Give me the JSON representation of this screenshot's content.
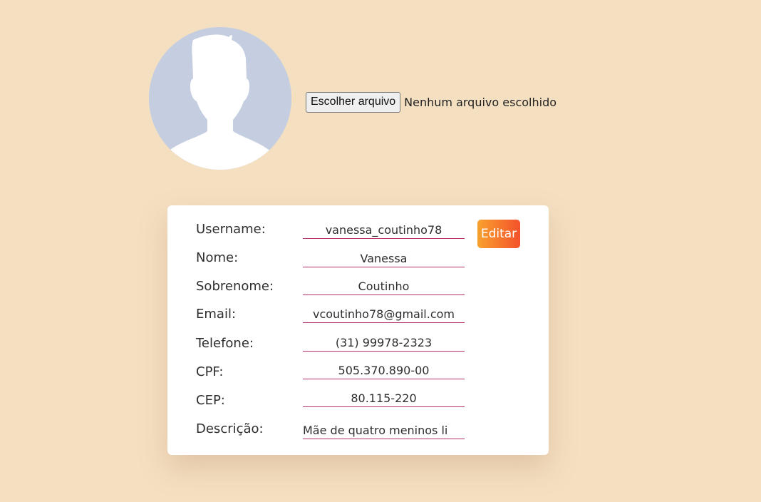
{
  "avatar": {
    "icon": "user-silhouette-icon",
    "colors": {
      "background": "#c5cee1",
      "silhouette": "#ffffff"
    }
  },
  "file_input": {
    "button_label": "Escolher arquivo",
    "status_text": "Nenhum arquivo escolhido"
  },
  "profile": {
    "edit_label": "Editar",
    "fields": {
      "username": {
        "label": "Username:",
        "value": "vanessa_coutinho78"
      },
      "nome": {
        "label": "Nome:",
        "value": "Vanessa"
      },
      "sobrenome": {
        "label": "Sobrenome:",
        "value": "Coutinho"
      },
      "email": {
        "label": "Email:",
        "value": "vcoutinho78@gmail.com"
      },
      "telefone": {
        "label": "Telefone:",
        "value": "(31) 99978-2323"
      },
      "cpf": {
        "label": "CPF:",
        "value": "505.370.890-00"
      },
      "cep": {
        "label": "CEP:",
        "value": "80.115-220"
      },
      "descricao": {
        "label": "Descrição:",
        "value": "Mãe de quatro meninos li"
      }
    }
  },
  "colors": {
    "page_background": "#f5dfc1",
    "card_background": "#ffffff",
    "field_underline": "#b3306a",
    "edit_gradient_start": "#f9a12e",
    "edit_gradient_end": "#f4522b"
  }
}
